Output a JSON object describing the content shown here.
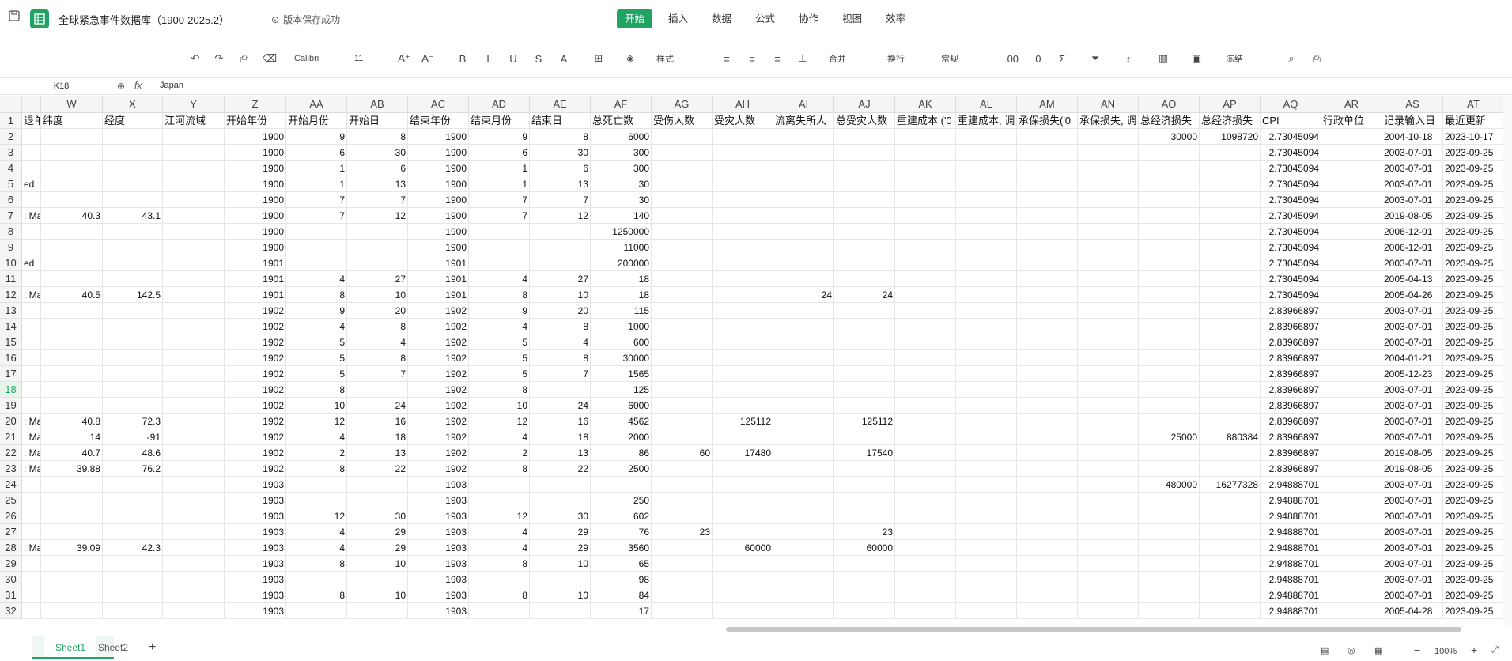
{
  "app": {
    "title": "全球紧急事件数据库（1900-2025.2）",
    "status": "版本保存成功",
    "menu": [
      "开始",
      "插入",
      "数据",
      "公式",
      "协作",
      "视图",
      "效率"
    ],
    "active_menu": "开始"
  },
  "toolbar": {
    "font": "Calibri",
    "size": "11",
    "style_label": "样式",
    "merge_label": "合并",
    "wrap_label": "换行",
    "number_format": "常规",
    "freeze_label": "冻结"
  },
  "formula": {
    "cell_ref": "K18",
    "fx": "fx",
    "value": "Japan"
  },
  "columns": [
    {
      "id": "",
      "w": 28
    },
    {
      "id": "",
      "w": 24
    },
    {
      "id": "W",
      "w": 78
    },
    {
      "id": "X",
      "w": 76
    },
    {
      "id": "Y",
      "w": 78
    },
    {
      "id": "Z",
      "w": 78
    },
    {
      "id": "AA",
      "w": 77
    },
    {
      "id": "AB",
      "w": 77
    },
    {
      "id": "AC",
      "w": 77
    },
    {
      "id": "AD",
      "w": 77
    },
    {
      "id": "AE",
      "w": 77
    },
    {
      "id": "AF",
      "w": 77
    },
    {
      "id": "AG",
      "w": 77
    },
    {
      "id": "AH",
      "w": 77
    },
    {
      "id": "AI",
      "w": 77
    },
    {
      "id": "AJ",
      "w": 77
    },
    {
      "id": "AK",
      "w": 77
    },
    {
      "id": "AL",
      "w": 77
    },
    {
      "id": "AM",
      "w": 77
    },
    {
      "id": "AN",
      "w": 77
    },
    {
      "id": "AO",
      "w": 77
    },
    {
      "id": "AP",
      "w": 77
    },
    {
      "id": "AQ",
      "w": 77
    },
    {
      "id": "AR",
      "w": 77
    },
    {
      "id": "AS",
      "w": 77
    },
    {
      "id": "AT",
      "w": 77
    }
  ],
  "rows": [
    [
      "退单",
      "纬度",
      "经度",
      "江河流域",
      "开始年份",
      "开始月份",
      "开始日",
      "结束年份",
      "结束月份",
      "结束日",
      "总死亡数",
      "受伤人数",
      "受灾人数",
      "流离失所人",
      "总受灾人数",
      "重建成本 ('0",
      "重建成本, 调",
      "承保损失('0",
      "承保损失, 调",
      "总经济损失",
      "总经济损失",
      "CPI",
      "行政单位",
      "记录输入日",
      "最近更新"
    ],
    [
      "",
      "",
      "",
      "",
      "1900",
      "9",
      "8",
      "1900",
      "9",
      "8",
      "6000",
      "",
      "",
      "",
      "",
      "",
      "",
      "",
      "",
      "30000",
      "1098720",
      "2.73045094",
      "",
      "2004-10-18",
      "2023-10-17"
    ],
    [
      "",
      "",
      "",
      "",
      "1900",
      "6",
      "30",
      "1900",
      "6",
      "30",
      "300",
      "",
      "",
      "",
      "",
      "",
      "",
      "",
      "",
      "",
      "",
      "2.73045094",
      "",
      "2003-07-01",
      "2023-09-25"
    ],
    [
      "",
      "",
      "",
      "",
      "1900",
      "1",
      "6",
      "1900",
      "1",
      "6",
      "300",
      "",
      "",
      "",
      "",
      "",
      "",
      "",
      "",
      "",
      "",
      "2.73045094",
      "",
      "2003-07-01",
      "2023-09-25"
    ],
    [
      "ed",
      "",
      "",
      "",
      "1900",
      "1",
      "13",
      "1900",
      "1",
      "13",
      "30",
      "",
      "",
      "",
      "",
      "",
      "",
      "",
      "",
      "",
      "",
      "2.73045094",
      "",
      "2003-07-01",
      "2023-09-25"
    ],
    [
      "",
      "",
      "",
      "",
      "1900",
      "7",
      "7",
      "1900",
      "7",
      "7",
      "30",
      "",
      "",
      "",
      "",
      "",
      "",
      "",
      "",
      "",
      "",
      "2.73045094",
      "",
      "2003-07-01",
      "2023-09-25"
    ],
    [
      ": Ma",
      "40.3",
      "43.1",
      "",
      "1900",
      "7",
      "12",
      "1900",
      "7",
      "12",
      "140",
      "",
      "",
      "",
      "",
      "",
      "",
      "",
      "",
      "",
      "",
      "2.73045094",
      "",
      "2019-08-05",
      "2023-09-25"
    ],
    [
      "",
      "",
      "",
      "",
      "1900",
      "",
      "",
      "1900",
      "",
      "",
      "1250000",
      "",
      "",
      "",
      "",
      "",
      "",
      "",
      "",
      "",
      "",
      "2.73045094",
      "",
      "2006-12-01",
      "2023-09-25"
    ],
    [
      "",
      "",
      "",
      "",
      "1900",
      "",
      "",
      "1900",
      "",
      "",
      "11000",
      "",
      "",
      "",
      "",
      "",
      "",
      "",
      "",
      "",
      "",
      "2.73045094",
      "",
      "2006-12-01",
      "2023-09-25"
    ],
    [
      "ed",
      "",
      "",
      "",
      "1901",
      "",
      "",
      "1901",
      "",
      "",
      "200000",
      "",
      "",
      "",
      "",
      "",
      "",
      "",
      "",
      "",
      "",
      "2.73045094",
      "",
      "2003-07-01",
      "2023-09-25"
    ],
    [
      "",
      "",
      "",
      "",
      "1901",
      "4",
      "27",
      "1901",
      "4",
      "27",
      "18",
      "",
      "",
      "",
      "",
      "",
      "",
      "",
      "",
      "",
      "",
      "2.73045094",
      "",
      "2005-04-13",
      "2023-09-25"
    ],
    [
      ": Ma",
      "40.5",
      "142.5",
      "",
      "1901",
      "8",
      "10",
      "1901",
      "8",
      "10",
      "18",
      "",
      "",
      "24",
      "24",
      "",
      "",
      "",
      "",
      "",
      "",
      "2.73045094",
      "",
      "2005-04-26",
      "2023-09-25"
    ],
    [
      "",
      "",
      "",
      "",
      "1902",
      "9",
      "20",
      "1902",
      "9",
      "20",
      "115",
      "",
      "",
      "",
      "",
      "",
      "",
      "",
      "",
      "",
      "",
      "2.83966897",
      "",
      "2003-07-01",
      "2023-09-25"
    ],
    [
      "",
      "",
      "",
      "",
      "1902",
      "4",
      "8",
      "1902",
      "4",
      "8",
      "1000",
      "",
      "",
      "",
      "",
      "",
      "",
      "",
      "",
      "",
      "",
      "2.83966897",
      "",
      "2003-07-01",
      "2023-09-25"
    ],
    [
      "",
      "",
      "",
      "",
      "1902",
      "5",
      "4",
      "1902",
      "5",
      "4",
      "600",
      "",
      "",
      "",
      "",
      "",
      "",
      "",
      "",
      "",
      "",
      "2.83966897",
      "",
      "2003-07-01",
      "2023-09-25"
    ],
    [
      "",
      "",
      "",
      "",
      "1902",
      "5",
      "8",
      "1902",
      "5",
      "8",
      "30000",
      "",
      "",
      "",
      "",
      "",
      "",
      "",
      "",
      "",
      "",
      "2.83966897",
      "",
      "2004-01-21",
      "2023-09-25"
    ],
    [
      "",
      "",
      "",
      "",
      "1902",
      "5",
      "7",
      "1902",
      "5",
      "7",
      "1565",
      "",
      "",
      "",
      "",
      "",
      "",
      "",
      "",
      "",
      "",
      "2.83966897",
      "",
      "2005-12-23",
      "2023-09-25"
    ],
    [
      "",
      "",
      "",
      "",
      "1902",
      "8",
      "",
      "1902",
      "8",
      "",
      "125",
      "",
      "",
      "",
      "",
      "",
      "",
      "",
      "",
      "",
      "",
      "2.83966897",
      "",
      "2003-07-01",
      "2023-09-25"
    ],
    [
      "",
      "",
      "",
      "",
      "1902",
      "10",
      "24",
      "1902",
      "10",
      "24",
      "6000",
      "",
      "",
      "",
      "",
      "",
      "",
      "",
      "",
      "",
      "",
      "2.83966897",
      "",
      "2003-07-01",
      "2023-09-25"
    ],
    [
      ": Ma",
      "40.8",
      "72.3",
      "",
      "1902",
      "12",
      "16",
      "1902",
      "12",
      "16",
      "4562",
      "",
      "125112",
      "",
      "125112",
      "",
      "",
      "",
      "",
      "",
      "",
      "2.83966897",
      "",
      "2003-07-01",
      "2023-09-25"
    ],
    [
      ": Ma",
      "14",
      "-91",
      "",
      "1902",
      "4",
      "18",
      "1902",
      "4",
      "18",
      "2000",
      "",
      "",
      "",
      "",
      "",
      "",
      "",
      "",
      "25000",
      "880384",
      "2.83966897",
      "",
      "2003-07-01",
      "2023-09-25"
    ],
    [
      ": Ma",
      "40.7",
      "48.6",
      "",
      "1902",
      "2",
      "13",
      "1902",
      "2",
      "13",
      "86",
      "60",
      "17480",
      "",
      "17540",
      "",
      "",
      "",
      "",
      "",
      "",
      "2.83966897",
      "",
      "2019-08-05",
      "2023-09-25"
    ],
    [
      ": Ma",
      "39.88",
      "76.2",
      "",
      "1902",
      "8",
      "22",
      "1902",
      "8",
      "22",
      "2500",
      "",
      "",
      "",
      "",
      "",
      "",
      "",
      "",
      "",
      "",
      "2.83966897",
      "",
      "2019-08-05",
      "2023-09-25"
    ],
    [
      "",
      "",
      "",
      "",
      "1903",
      "",
      "",
      "1903",
      "",
      "",
      "",
      "",
      "",
      "",
      "",
      "",
      "",
      "",
      "",
      "480000",
      "16277328",
      "2.94888701",
      "",
      "2003-07-01",
      "2023-09-25"
    ],
    [
      "",
      "",
      "",
      "",
      "1903",
      "",
      "",
      "1903",
      "",
      "",
      "250",
      "",
      "",
      "",
      "",
      "",
      "",
      "",
      "",
      "",
      "",
      "2.94888701",
      "",
      "2003-07-01",
      "2023-09-25"
    ],
    [
      "",
      "",
      "",
      "",
      "1903",
      "12",
      "30",
      "1903",
      "12",
      "30",
      "602",
      "",
      "",
      "",
      "",
      "",
      "",
      "",
      "",
      "",
      "",
      "2.94888701",
      "",
      "2003-07-01",
      "2023-09-25"
    ],
    [
      "",
      "",
      "",
      "",
      "1903",
      "4",
      "29",
      "1903",
      "4",
      "29",
      "76",
      "23",
      "",
      "",
      "23",
      "",
      "",
      "",
      "",
      "",
      "",
      "2.94888701",
      "",
      "2003-07-01",
      "2023-09-25"
    ],
    [
      ": Ma",
      "39.09",
      "42.3",
      "",
      "1903",
      "4",
      "29",
      "1903",
      "4",
      "29",
      "3560",
      "",
      "60000",
      "",
      "60000",
      "",
      "",
      "",
      "",
      "",
      "",
      "2.94888701",
      "",
      "2003-07-01",
      "2023-09-25"
    ],
    [
      "",
      "",
      "",
      "",
      "1903",
      "8",
      "10",
      "1903",
      "8",
      "10",
      "65",
      "",
      "",
      "",
      "",
      "",
      "",
      "",
      "",
      "",
      "",
      "2.94888701",
      "",
      "2003-07-01",
      "2023-09-25"
    ],
    [
      "",
      "",
      "",
      "",
      "1903",
      "",
      "",
      "1903",
      "",
      "",
      "98",
      "",
      "",
      "",
      "",
      "",
      "",
      "",
      "",
      "",
      "",
      "2.94888701",
      "",
      "2003-07-01",
      "2023-09-25"
    ],
    [
      "",
      "",
      "",
      "",
      "1903",
      "8",
      "10",
      "1903",
      "8",
      "10",
      "84",
      "",
      "",
      "",
      "",
      "",
      "",
      "",
      "",
      "",
      "",
      "2.94888701",
      "",
      "2003-07-01",
      "2023-09-25"
    ],
    [
      "",
      "",
      "",
      "",
      "1903",
      "",
      "",
      "1903",
      "",
      "",
      "17",
      "",
      "",
      "",
      "",
      "",
      "",
      "",
      "",
      "",
      "",
      "2.94888701",
      "",
      "2005-04-28",
      "2023-09-25"
    ]
  ],
  "sheets": [
    "Sheet1",
    "Sheet2"
  ],
  "active_sheet": "Sheet1",
  "add_sheet": "+",
  "zoom": "100%"
}
